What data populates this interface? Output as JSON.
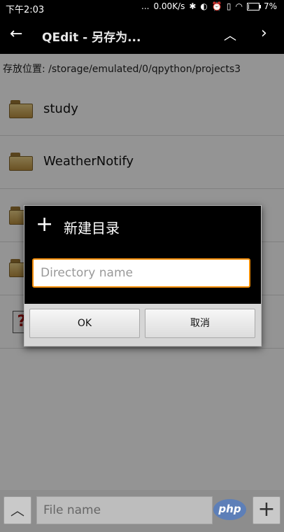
{
  "status_bar": {
    "time": "下午2:03",
    "dots": "...",
    "net_speed": "0.00K/s",
    "battery": "7%",
    "icons": [
      "bluetooth-icon",
      "toggle-icon",
      "alarm-icon",
      "vibrate-icon",
      "wifi-icon",
      "battery-icon"
    ]
  },
  "app_bar": {
    "title": "QEdit - 另存为...",
    "back_icon": "arrow-left-icon",
    "up_icon": "chevron-up-icon",
    "next_icon": "chevron-right-icon"
  },
  "path": {
    "text": "存放位置: /storage/emulated/0/qpython/projects3"
  },
  "file_list": [
    {
      "name": "study",
      "icon": "folder-icon"
    },
    {
      "name": "WeatherNotify",
      "icon": "folder-icon"
    },
    {
      "name": "",
      "icon": "folder-icon"
    },
    {
      "name": "",
      "icon": "folder-icon"
    },
    {
      "name": "",
      "icon": "unknown-file-icon"
    }
  ],
  "dialog": {
    "title": "新建目录",
    "icon": "plus-icon",
    "input_placeholder": "Directory name",
    "input_value": "",
    "ok_label": "OK",
    "cancel_label": "取消",
    "accent_color": "#f28c00"
  },
  "bottom_bar": {
    "file_name_placeholder": "File name",
    "file_name_value": "",
    "logo_text": "php",
    "up_icon": "chevron-up-icon",
    "add_icon": "plus-icon"
  }
}
